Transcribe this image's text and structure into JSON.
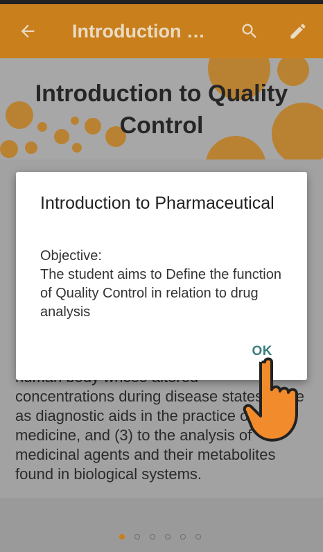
{
  "appbar": {
    "title": "Introduction to Quality Control",
    "back_icon": "arrow-left-icon",
    "search_icon": "search-icon",
    "edit_icon": "pencil-icon",
    "color": "#c97f1c"
  },
  "banner": {
    "heading": "Introduction to Quality Control"
  },
  "content": {
    "partial_line": "human body whose altered",
    "paragraph_tail": "concentrations during disease states serve as diagnostic aids in the practice of medicine, and (3) to the analysis of medicinal agents and their metabolites found in biological systems."
  },
  "dialog": {
    "title": "Introduction to Pharmaceutical",
    "message": "Objective:\nThe student aims to Define the function of Quality Control in relation to drug analysis",
    "ok_label": "OK"
  },
  "pager": {
    "count": 6,
    "active_index": 0
  },
  "overlay": {
    "hand_icon": "pointing-hand-icon"
  }
}
